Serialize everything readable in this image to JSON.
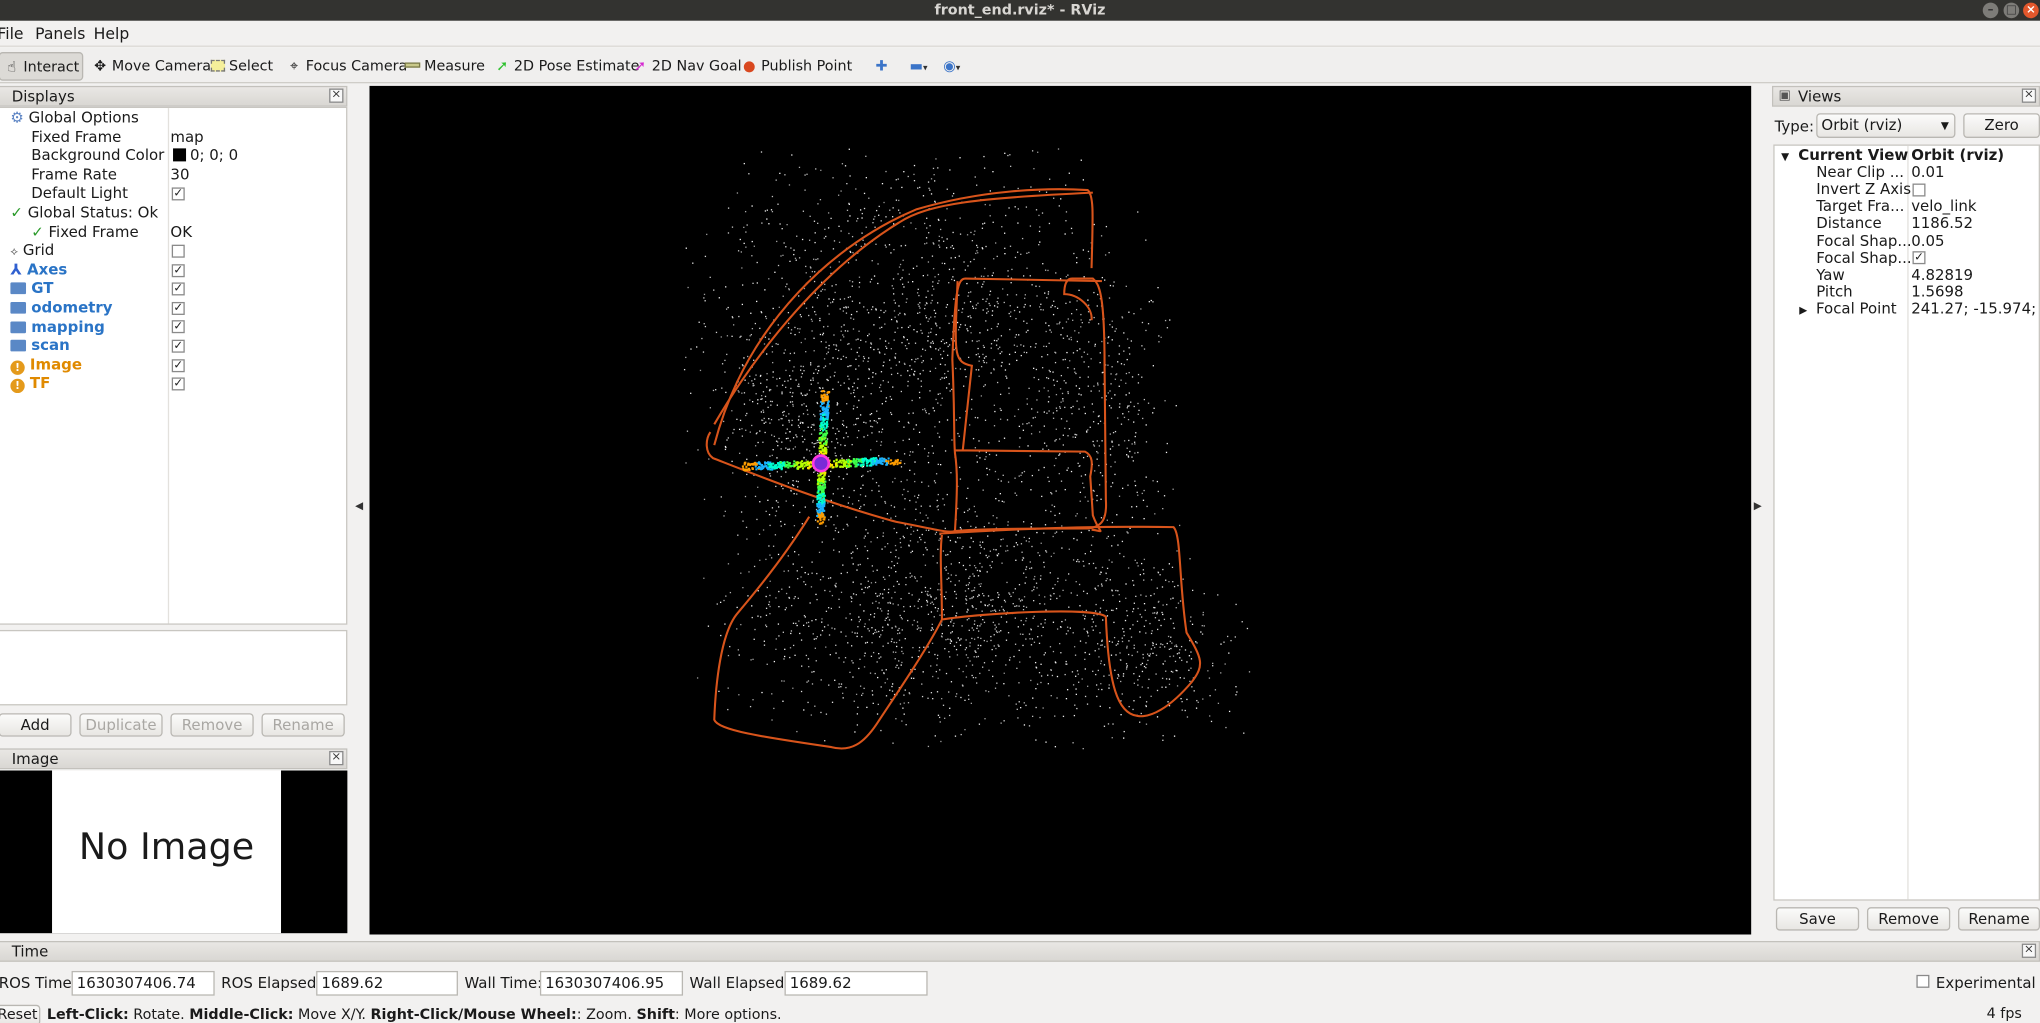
{
  "window": {
    "title": "front_end.rviz* - RViz"
  },
  "menu": {
    "file": "File",
    "panels": "Panels",
    "help": "Help"
  },
  "toolbar": {
    "interact": "Interact",
    "move_camera": "Move Camera",
    "select": "Select",
    "focus_camera": "Focus Camera",
    "measure": "Measure",
    "pose_estimate": "2D Pose Estimate",
    "nav_goal": "2D Nav Goal",
    "publish_point": "Publish Point"
  },
  "displays": {
    "title": "Displays",
    "global_options": "Global Options",
    "fixed_frame_label": "Fixed Frame",
    "fixed_frame_value": "map",
    "bg_color_label": "Background Color",
    "bg_color_value": "0; 0; 0",
    "bg_color_swatch": "#000000",
    "frame_rate_label": "Frame Rate",
    "frame_rate_value": "30",
    "default_light_label": "Default Light",
    "global_status": "Global Status: Ok",
    "fixed_frame_status_label": "Fixed Frame",
    "fixed_frame_status_value": "OK",
    "items": [
      {
        "label": "Grid",
        "checked": false
      },
      {
        "label": "Axes",
        "checked": true
      },
      {
        "label": "GT",
        "checked": true
      },
      {
        "label": "odometry",
        "checked": true
      },
      {
        "label": "mapping",
        "checked": true
      },
      {
        "label": "scan",
        "checked": true
      },
      {
        "label": "Image",
        "checked": true
      },
      {
        "label": "TF",
        "checked": true
      }
    ],
    "buttons": {
      "add": "Add",
      "duplicate": "Duplicate",
      "remove": "Remove",
      "rename": "Rename"
    }
  },
  "image_panel": {
    "title": "Image",
    "placeholder": "No Image"
  },
  "views": {
    "title": "Views",
    "type_label": "Type:",
    "type_value": "Orbit (rviz)",
    "zero": "Zero",
    "current_view_label": "Current View",
    "current_view_value": "Orbit (rviz)",
    "props": [
      {
        "label": "Near Clip ...",
        "value": "0.01"
      },
      {
        "label": "Invert Z Axis",
        "value": ""
      },
      {
        "label": "Target Fra...",
        "value": "velo_link"
      },
      {
        "label": "Distance",
        "value": "1186.52"
      },
      {
        "label": "Focal Shap...",
        "value": "0.05"
      },
      {
        "label": "Focal Shap...",
        "value": ""
      },
      {
        "label": "Yaw",
        "value": "4.82819"
      },
      {
        "label": "Pitch",
        "value": "1.5698"
      },
      {
        "label": "Focal Point",
        "value": "241.27; -15.974; ..."
      }
    ],
    "buttons": {
      "save": "Save",
      "remove": "Remove",
      "rename": "Rename"
    }
  },
  "time": {
    "title": "Time",
    "ros_time_label": "ROS Time:",
    "ros_time": "1630307406.74",
    "ros_elapsed_label": "ROS Elapsed:",
    "ros_elapsed": "1689.62",
    "wall_time_label": "Wall Time:",
    "wall_time": "1630307406.95",
    "wall_elapsed_label": "Wall Elapsed:",
    "wall_elapsed": "1689.62",
    "experimental": "Experimental"
  },
  "status": {
    "reset": "Reset",
    "hint_b1": "Left-Click:",
    "hint_t1": " Rotate. ",
    "hint_b2": "Middle-Click:",
    "hint_t2": " Move X/Y. ",
    "hint_b3": "Right-Click/Mouse Wheel:",
    "hint_t3": ": Zoom. ",
    "hint_b4": "Shift",
    "hint_t4": ": More options.",
    "fps": "4 fps"
  },
  "colors": {
    "trajectory": "#e0571a",
    "viewport_bg": "#000000"
  }
}
